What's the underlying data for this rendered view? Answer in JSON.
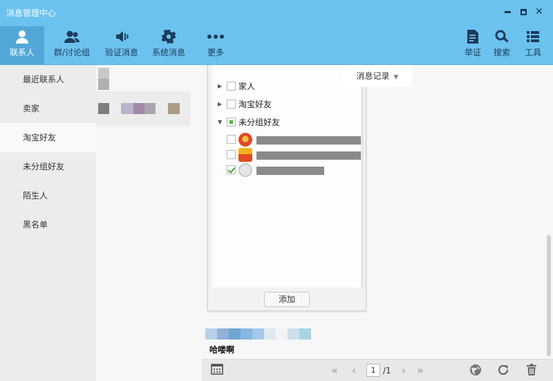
{
  "window": {
    "title": "消息管理中心",
    "controls": {
      "minimize": "minimize-icon",
      "maximize": "maximize-icon",
      "close": "close-icon"
    }
  },
  "nav": {
    "left": [
      {
        "label": "联系人",
        "icon": "person-icon",
        "active": true
      },
      {
        "label": "群/讨论组",
        "icon": "group-icon",
        "active": false
      },
      {
        "label": "验证消息",
        "icon": "speaker-icon",
        "active": false
      },
      {
        "label": "系统消息",
        "icon": "gear-icon",
        "active": false
      },
      {
        "label": "更多",
        "icon": "more-dots-icon",
        "active": false
      }
    ],
    "right": [
      {
        "label": "举证",
        "icon": "report-icon"
      },
      {
        "label": "搜索",
        "icon": "search-icon"
      },
      {
        "label": "工具",
        "icon": "tools-list-icon"
      }
    ]
  },
  "sidebar": {
    "items": [
      {
        "label": "最近联系人",
        "selected": false
      },
      {
        "label": "卖家",
        "selected": false
      },
      {
        "label": "淘宝好友",
        "selected": true
      },
      {
        "label": "未分组好友",
        "selected": false
      },
      {
        "label": "陌生人",
        "selected": false
      },
      {
        "label": "黑名单",
        "selected": false
      }
    ]
  },
  "main": {
    "record_tab": {
      "label": "消息记录",
      "icon": "caret-down-icon"
    },
    "picker": {
      "groups": [
        {
          "label": "家人",
          "expanded": false,
          "state": "unchecked"
        },
        {
          "label": "淘宝好友",
          "expanded": false,
          "state": "unchecked"
        },
        {
          "label": "未分组好友",
          "expanded": true,
          "state": "partial"
        }
      ],
      "friends": [
        {
          "checked": false,
          "avatar_color": "#e0492a"
        },
        {
          "checked": false,
          "avatar_color": "#f08a1c"
        },
        {
          "checked": true,
          "avatar_color": "#cfcfcf"
        }
      ],
      "add_label": "添加"
    },
    "message": {
      "text": "哈喽啊"
    }
  },
  "bottombar": {
    "page_current": "1",
    "page_total": "/1",
    "icons": [
      "calendar-icon",
      "first-page-icon",
      "prev-page-icon",
      "next-page-icon",
      "last-page-icon",
      "globe-icon",
      "refresh-icon",
      "trash-icon"
    ]
  }
}
